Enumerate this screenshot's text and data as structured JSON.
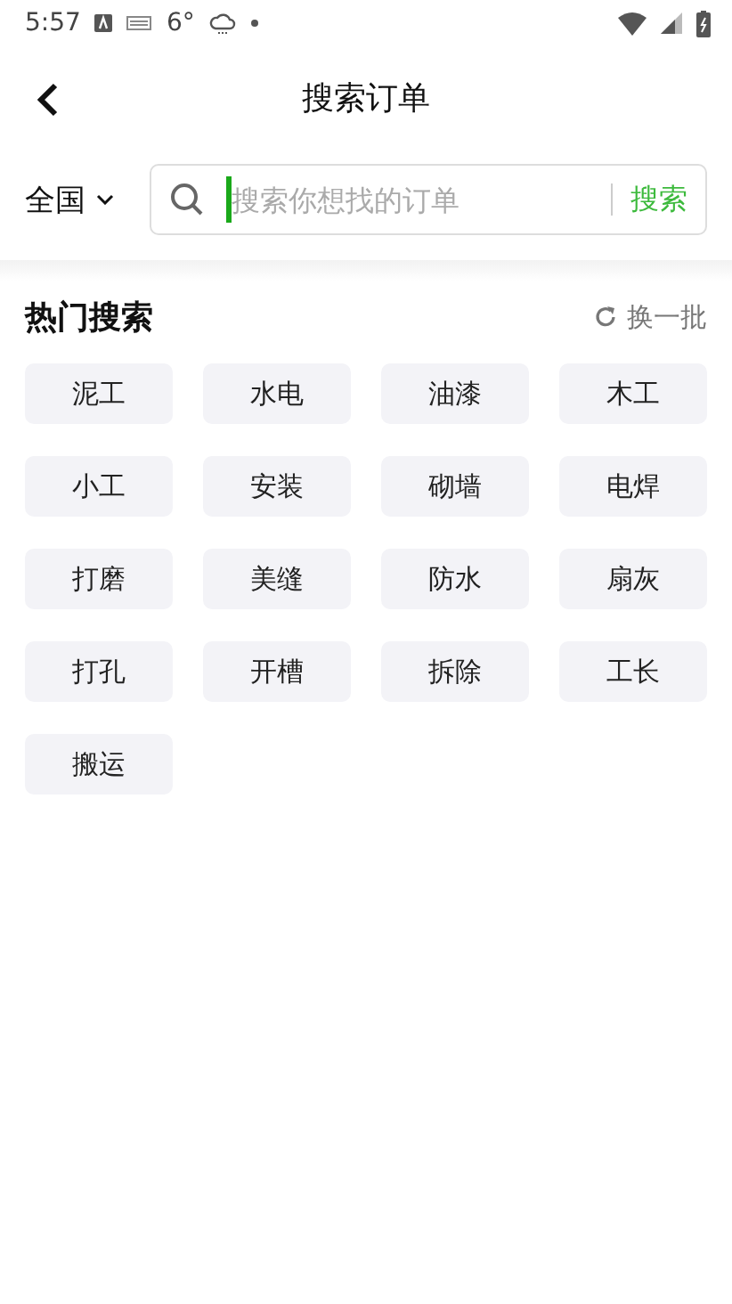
{
  "status_bar": {
    "time": "5:57",
    "temperature": "6°"
  },
  "header": {
    "title": "搜索订单"
  },
  "search": {
    "region": "全国",
    "placeholder": "搜索你想找的订单",
    "button": "搜索"
  },
  "hot": {
    "title": "热门搜索",
    "refresh": "换一批",
    "tags": [
      "泥工",
      "水电",
      "油漆",
      "木工",
      "小工",
      "安装",
      "砌墙",
      "电焊",
      "打磨",
      "美缝",
      "防水",
      "扇灰",
      "打孔",
      "开槽",
      "拆除",
      "工长",
      "搬运"
    ]
  }
}
